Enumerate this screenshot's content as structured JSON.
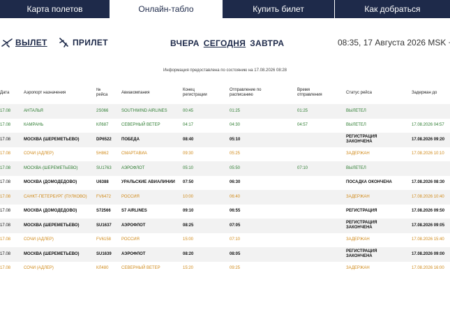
{
  "nav": {
    "tabs": [
      {
        "label": "Карта полетов"
      },
      {
        "label": "Онлайн-табло"
      },
      {
        "label": "Купить билет"
      },
      {
        "label": "Как добраться"
      }
    ]
  },
  "modes": {
    "departure": "ВЫЛЕТ",
    "arrival": "ПРИЛЕТ"
  },
  "days": {
    "yesterday": "ВЧЕРА",
    "today": "СЕГОДНЯ",
    "tomorrow": "ЗАВТРА"
  },
  "clock": "08:35, 17 Августа 2026 MSK +3",
  "info_text": "Информация предоставлена по состоянию на 17.08.2026 08:28",
  "columns": {
    "date": "Дата",
    "airport": "Аэропорт назначения",
    "flight": "№ рейса",
    "airline": "Авиакомпания",
    "reg_end": "Конец регистрации",
    "scheduled": "Отправление по расписанию",
    "dep_time": "Время отправления",
    "status": "Статус рейса",
    "delayed_until": "Задержан до"
  },
  "colors": {
    "navy": "#1e2a4a",
    "departed": "#2e7d32",
    "delayed": "#d08a1a"
  },
  "flights": [
    {
      "date": "17.08",
      "airport": "АНТАЛЬЯ",
      "flight": "2S066",
      "airline": "SOUTHWIND AIRLINES",
      "reg_end": "00:45",
      "scheduled": "01:25",
      "dep_time": "01:25",
      "status": "ВЫЛЕТЕЛ",
      "delayed_until": "",
      "state": "departed"
    },
    {
      "date": "17.08",
      "airport": "КАМРАНЬ",
      "flight": "КЛ687",
      "airline": "СЕВЕРНЫЙ ВЕТЕР",
      "reg_end": "04:17",
      "scheduled": "04:30",
      "dep_time": "04:57",
      "status": "ВЫЛЕТЕЛ",
      "delayed_until": "17.08.2026 04:57",
      "state": "departed"
    },
    {
      "date": "17.08",
      "airport": "МОСКВА (ШЕРЕМЕТЬЕВО)",
      "flight": "DP6522",
      "airline": "ПОБЕДА",
      "reg_end": "08:40",
      "scheduled": "05:10",
      "dep_time": "",
      "status": "РЕГИСТРАЦИЯ ЗАКОНЧЕНА",
      "delayed_until": "17.08.2026 09:20",
      "state": "normal"
    },
    {
      "date": "17.08",
      "airport": "СОЧИ (АДЛЕР)",
      "flight": "5Н862",
      "airline": "СМАРТАВИА",
      "reg_end": "09:30",
      "scheduled": "05:25",
      "dep_time": "",
      "status": "ЗАДЕРЖАН",
      "delayed_until": "17.08.2026 10:10",
      "state": "delayed"
    },
    {
      "date": "17.08",
      "airport": "МОСКВА (ШЕРЕМЕТЬЕВО)",
      "flight": "SU1763",
      "airline": "АЭРОФЛОТ",
      "reg_end": "05:10",
      "scheduled": "05:50",
      "dep_time": "07:10",
      "status": "ВЫЛЕТЕЛ",
      "delayed_until": "",
      "state": "departed"
    },
    {
      "date": "17.08",
      "airport": "МОСКВА (ДОМОДЕДОВО)",
      "flight": "U6388",
      "airline": "УРАЛЬСКИЕ АВИАЛИНИИ",
      "reg_end": "07:50",
      "scheduled": "06:30",
      "dep_time": "",
      "status": "ПОСАДКА ОКОНЧЕНА",
      "delayed_until": "17.08.2026 08:30",
      "state": "normal"
    },
    {
      "date": "17.08",
      "airport": "САНКТ-ПЕТЕРБУРГ (ПУЛКОВО)",
      "flight": "FV6472",
      "airline": "РОССИЯ",
      "reg_end": "10:00",
      "scheduled": "06:40",
      "dep_time": "",
      "status": "ЗАДЕРЖАН",
      "delayed_until": "17.08.2026 10:40",
      "state": "delayed"
    },
    {
      "date": "17.08",
      "airport": "МОСКВА (ДОМОДЕДОВО)",
      "flight": "S72566",
      "airline": "S7 AIRLINES",
      "reg_end": "09:10",
      "scheduled": "06:55",
      "dep_time": "",
      "status": "РЕГИСТРАЦИЯ",
      "delayed_until": "17.08.2026 09:50",
      "state": "normal"
    },
    {
      "date": "17.08",
      "airport": "МОСКВА (ШЕРЕМЕТЬЕВО)",
      "flight": "SU1637",
      "airline": "АЭРОФЛОТ",
      "reg_end": "08:25",
      "scheduled": "07:05",
      "dep_time": "",
      "status": "РЕГИСТРАЦИЯ ЗАКОНЧЕНА",
      "delayed_until": "17.08.2026 09:05",
      "state": "normal"
    },
    {
      "date": "17.08",
      "airport": "СОЧИ (АДЛЕР)",
      "flight": "FV6158",
      "airline": "РОССИЯ",
      "reg_end": "15:00",
      "scheduled": "07:10",
      "dep_time": "",
      "status": "ЗАДЕРЖАН",
      "delayed_until": "17.08.2026 15:40",
      "state": "delayed"
    },
    {
      "date": "17.08",
      "airport": "МОСКВА (ШЕРЕМЕТЬЕВО)",
      "flight": "SU1639",
      "airline": "АЭРОФЛОТ",
      "reg_end": "08:20",
      "scheduled": "08:05",
      "dep_time": "",
      "status": "РЕГИСТРАЦИЯ ЗАКОНЧЕНА",
      "delayed_until": "17.08.2026 09:00",
      "state": "normal"
    },
    {
      "date": "17.08",
      "airport": "СОЧИ (АДЛЕР)",
      "flight": "КЛ480",
      "airline": "СЕВЕРНЫЙ ВЕТЕР",
      "reg_end": "15:20",
      "scheduled": "09:25",
      "dep_time": "",
      "status": "ЗАДЕРЖАН",
      "delayed_until": "17.08.2026 16:00",
      "state": "delayed"
    }
  ]
}
